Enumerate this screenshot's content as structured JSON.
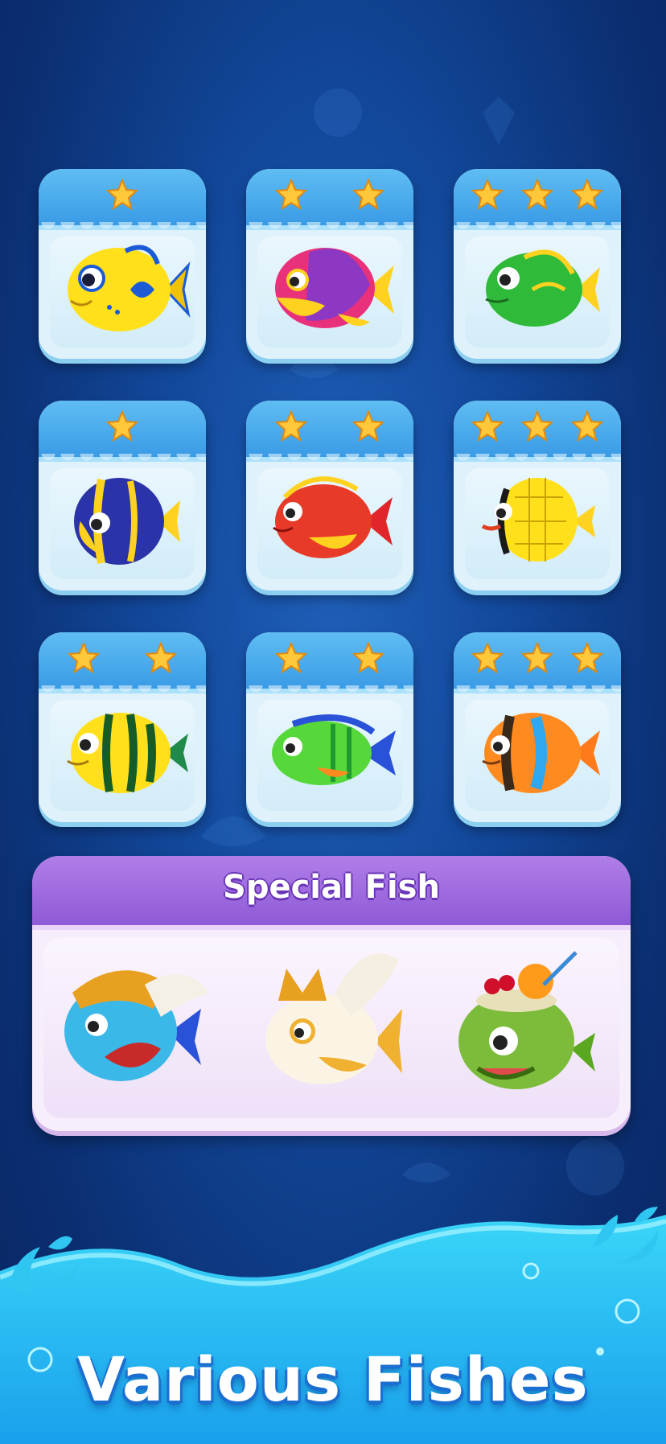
{
  "grid": [
    {
      "id": "yellow-fish",
      "stars": 1
    },
    {
      "id": "pink-fish",
      "stars": 2
    },
    {
      "id": "green-fish",
      "stars": 3
    },
    {
      "id": "blue-striped-fish",
      "stars": 1
    },
    {
      "id": "red-fish",
      "stars": 2
    },
    {
      "id": "yellow-butterfly-fish",
      "stars": 3
    },
    {
      "id": "green-striped-fish",
      "stars": 2
    },
    {
      "id": "green-blue-fish",
      "stars": 2
    },
    {
      "id": "orange-clown-fish",
      "stars": 3
    }
  ],
  "special": {
    "title": "Special Fish",
    "fishes": [
      "warrior-fish",
      "winged-gold-fish",
      "coconut-fish"
    ]
  },
  "footer": {
    "title": "Various Fishes"
  },
  "colors": {
    "background": "#134a9e",
    "tile_header": "#3a9be6",
    "star": "#ffc83a",
    "special_header": "#8f5ad6",
    "water": "#2fc6f2"
  }
}
